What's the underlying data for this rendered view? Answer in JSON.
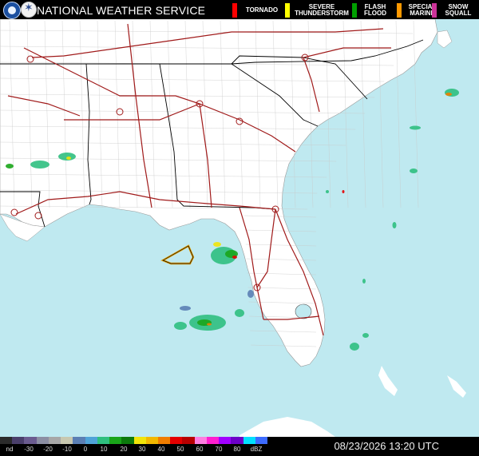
{
  "header": {
    "agency": "NATIONAL WEATHER SERVICE",
    "legend": [
      {
        "label": "TORNADO",
        "color": "#ff0000"
      },
      {
        "label": "SEVERE THUNDERSTORM",
        "color": "#ffff00"
      },
      {
        "label": "FLASH FLOOD",
        "color": "#00a000"
      },
      {
        "label": "SPECIAL MARINE",
        "color": "#ff9900"
      },
      {
        "label": "SNOW SQUALL",
        "color": "#cc3399"
      }
    ]
  },
  "icons": [
    "noaa-logo-icon",
    "nws-logo-icon"
  ],
  "scale": {
    "ticks": [
      "nd",
      "-30",
      "-20",
      "-10",
      "0",
      "10",
      "20",
      "30",
      "40",
      "50",
      "60",
      "70",
      "80",
      "dBZ"
    ],
    "colors": [
      "#2b2b2b",
      "#4a3f6b",
      "#6b5c90",
      "#8c8fa3",
      "#a7a7a7",
      "#c8c8b0",
      "#5b7fb4",
      "#4fa3d8",
      "#2fbf7f",
      "#19a519",
      "#0c7a0c",
      "#f1e40a",
      "#f2b800",
      "#f07d00",
      "#e40000",
      "#b80000",
      "#ff7de0",
      "#ff1fd0",
      "#a000ff",
      "#6b00c8",
      "#00e0ff",
      "#3d6bff"
    ]
  },
  "footer": {
    "timestamp": "08/23/2026 13:20 UTC"
  }
}
